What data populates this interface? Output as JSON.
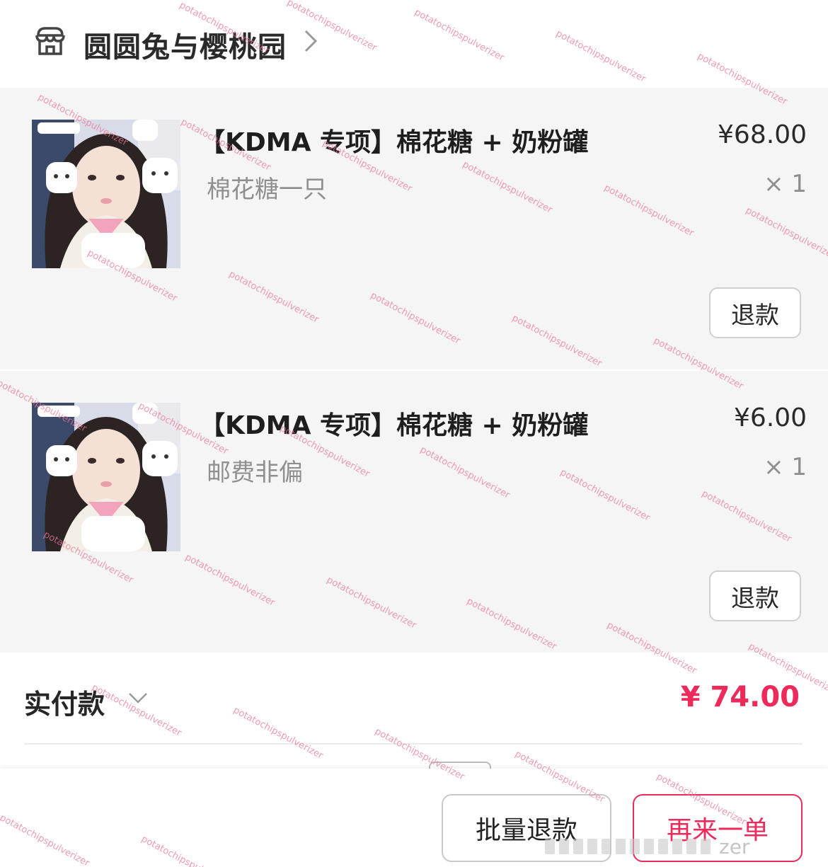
{
  "shop": {
    "name": "圆圆兔与樱桃园",
    "icon": "shop-icon",
    "chevron_icon": "chevron-right-icon"
  },
  "items": [
    {
      "title": "【KDMA 专项】棉花糖 + 奶粉罐",
      "sku": "棉花糖一只",
      "price": "¥68.00",
      "qty": "× 1",
      "refund_label": "退款",
      "thumbnail": "product-photo-icon"
    },
    {
      "title": "【KDMA 专项】棉花糖 + 奶粉罐",
      "sku": "邮费非偏",
      "price": "¥6.00",
      "qty": "× 1",
      "refund_label": "退款",
      "thumbnail": "product-photo-icon"
    }
  ],
  "payment": {
    "label": "实付款",
    "amount": "¥ 74.00",
    "expand_icon": "chevron-down-icon"
  },
  "actions": {
    "batch_refund_label": "批量退款",
    "reorder_label": "再来一单"
  },
  "watermark": {
    "text": "potatochipspulverizer",
    "corner_text": "zer"
  },
  "colors": {
    "accent": "#ee2a5a",
    "item_bg": "#f5f5f5",
    "watermark": "#e97896"
  }
}
